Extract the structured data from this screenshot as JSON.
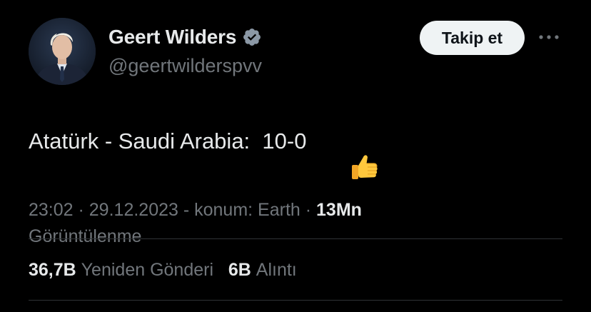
{
  "author": {
    "display_name": "Geert Wilders",
    "handle": "@geertwilderspvv",
    "verified_color": "#8b98a5",
    "avatar_icon": "profile-photo"
  },
  "header": {
    "follow_label": "Takip et",
    "more_icon": "ellipsis-icon"
  },
  "tweet": {
    "text": "Atatürk - Saudi Arabia:  10-0",
    "emoji_icon": "thumbs-up-icon"
  },
  "meta": {
    "time": "23:02",
    "sep1": " · ",
    "date": "29.12.2023",
    "sep2": " - ",
    "location": "konum: Earth",
    "sep3": " · ",
    "views_count": "13Mn",
    "views_label": "Görüntülenme"
  },
  "stats": {
    "retweets_count": "36,7B",
    "retweets_label": "Yeniden Gönderi",
    "quotes_count": "6B",
    "quotes_label": "Alıntı"
  },
  "colors": {
    "background": "#000000",
    "primary_text": "#e7e9ea",
    "secondary_text": "#71767b",
    "divider": "#2f3336",
    "follow_button_bg": "#eff3f4"
  }
}
